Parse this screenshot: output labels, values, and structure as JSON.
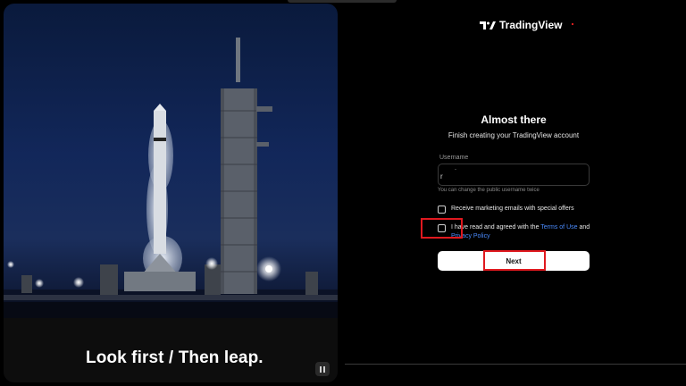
{
  "hero": {
    "tagline": "Look first / Then leap.",
    "pause_icon": "pause-icon"
  },
  "brand": {
    "name": "TradingView",
    "logo_icon": "tradingview-logo-icon"
  },
  "form": {
    "title": "Almost there",
    "subtitle": "Finish creating your TradingView account",
    "username": {
      "label": "Username",
      "value": "r",
      "trailing_text": "ˆ",
      "hint": "You can change the public username twice"
    },
    "marketing_checkbox_label": "Receive marketing emails with special offers",
    "terms": {
      "prefix": "I have read and agreed with the ",
      "terms_link": "Terms of Use",
      "middle": " and ",
      "privacy_link": "Privacy Policy"
    },
    "next_label": "Next"
  },
  "colors": {
    "highlight": "#e0191f",
    "link": "#4b8cff",
    "background": "#000000"
  }
}
